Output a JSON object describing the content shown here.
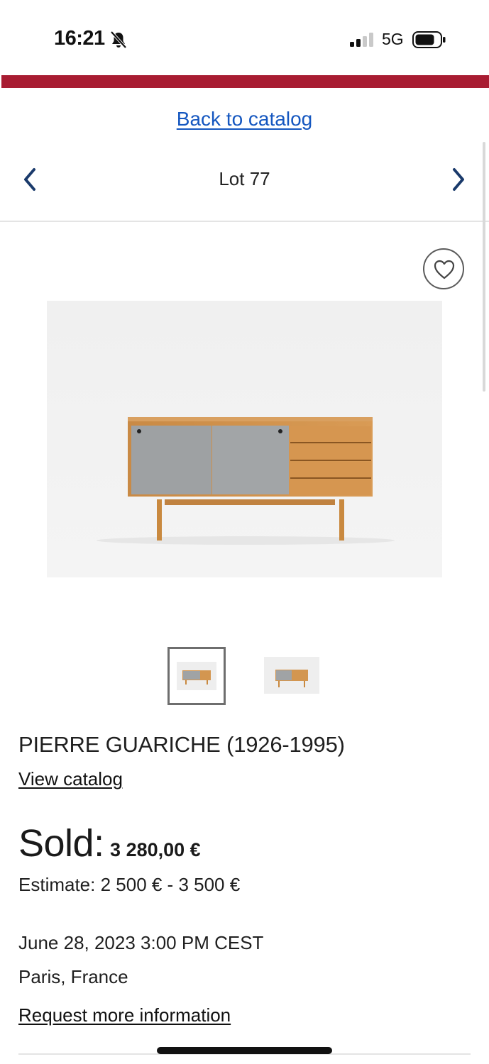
{
  "status_bar": {
    "time": "16:21",
    "network": "5G",
    "icons": [
      "bell-slash-icon",
      "signal-icon",
      "battery-icon"
    ]
  },
  "colors": {
    "brand_stripe": "#a81c32",
    "link": "#1557c0",
    "nav_arrow": "#1a3a6b"
  },
  "header": {
    "back_link": "Back to catalog",
    "lot_title": "Lot 77",
    "prev_icon": "chevron-left-icon",
    "next_icon": "chevron-right-icon"
  },
  "gallery": {
    "favorite_icon": "heart-icon",
    "main_image": "sideboard with grey sliding doors and four wooden drawers",
    "thumbnails": [
      {
        "selected": true
      },
      {
        "selected": false
      }
    ]
  },
  "lot": {
    "heading": "PIERRE GUARICHE (1926-1995)",
    "view_catalog": "View catalog",
    "sold_label": "Sold:",
    "sold_price": "3 280,00 €",
    "estimate": "Estimate: 2 500 € - 3 500 €",
    "date": "June 28, 2023 3:00 PM CEST",
    "location": "Paris, France",
    "request_info": "Request more information"
  }
}
